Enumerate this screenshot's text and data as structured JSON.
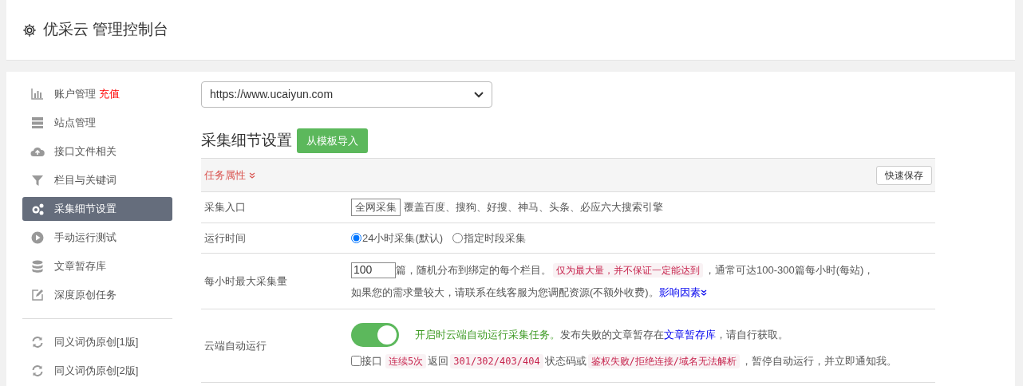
{
  "header": {
    "title": "优采云 管理控制台"
  },
  "sidebar": {
    "items": [
      {
        "kind": "bar-chart",
        "label": "账户管理",
        "badge": "充值",
        "selected": false
      },
      {
        "kind": "server",
        "label": "站点管理",
        "selected": false
      },
      {
        "kind": "cloud",
        "label": "接口文件相关",
        "selected": false
      },
      {
        "kind": "filter",
        "label": "栏目与关键词",
        "selected": false
      },
      {
        "kind": "gears",
        "label": "采集细节设置",
        "selected": true
      },
      {
        "kind": "play",
        "label": "手动运行测试",
        "selected": false
      },
      {
        "kind": "database",
        "label": "文章暂存库",
        "selected": false
      },
      {
        "kind": "edit",
        "label": "深度原创任务",
        "selected": false
      },
      {
        "kind": "divider"
      },
      {
        "kind": "refresh",
        "label": "同义词伪原创[1版]",
        "selected": false
      },
      {
        "kind": "refresh",
        "label": "同义词伪原创[2版]",
        "selected": false
      }
    ]
  },
  "site_select": {
    "value": "https://www.ucaiyun.com"
  },
  "section": {
    "title": "采集细节设置",
    "import_button": "从模板导入"
  },
  "table": {
    "header": {
      "label": "任务属性",
      "save_button": "快速保存"
    },
    "rows": [
      {
        "kind": "entry",
        "label": "采集入口",
        "select": "全网采集",
        "text": "覆盖百度、搜狗、好搜、神马、头条、必应六大搜索引擎"
      },
      {
        "kind": "radios",
        "label": "运行时间",
        "options": [
          {
            "label": "24小时采集(默认)",
            "selected": true
          },
          {
            "label": "指定时段采集",
            "selected": false
          }
        ]
      },
      {
        "kind": "max",
        "label": "每小时最大采集量",
        "value": "100",
        "text_1": "篇，随机分布到绑定的每个栏目。",
        "highlight": "仅为最大量，并不保证一定能达到",
        "text_2": "，通常可达100-300篇每小时(每站)，",
        "text_3": "如果您的需求量较大，请联系在线客服为您调配资源(不额外收费)。",
        "link": "影响因素"
      },
      {
        "kind": "cloud",
        "label": "云端自动运行",
        "on": true,
        "green_text": "开启时云端自动运行采集任务。",
        "text_1": "发布失败的文章暂存在",
        "link": "文章暂存库",
        "text_2": "，请自行获取。",
        "checkbox": {
          "checked": false,
          "label": "接口"
        },
        "parts": [
          {
            "kind": "code",
            "text": "连续5次"
          },
          {
            "kind": "text",
            "text": "返回"
          },
          {
            "kind": "code",
            "text": "301/302/403/404"
          },
          {
            "kind": "text",
            "text": "状态码或"
          },
          {
            "kind": "code",
            "text": "鉴权失败/拒绝连接/域名无法解析"
          },
          {
            "kind": "text",
            "text": "，暂停自动运行，并立即通知我。"
          }
        ]
      }
    ]
  }
}
